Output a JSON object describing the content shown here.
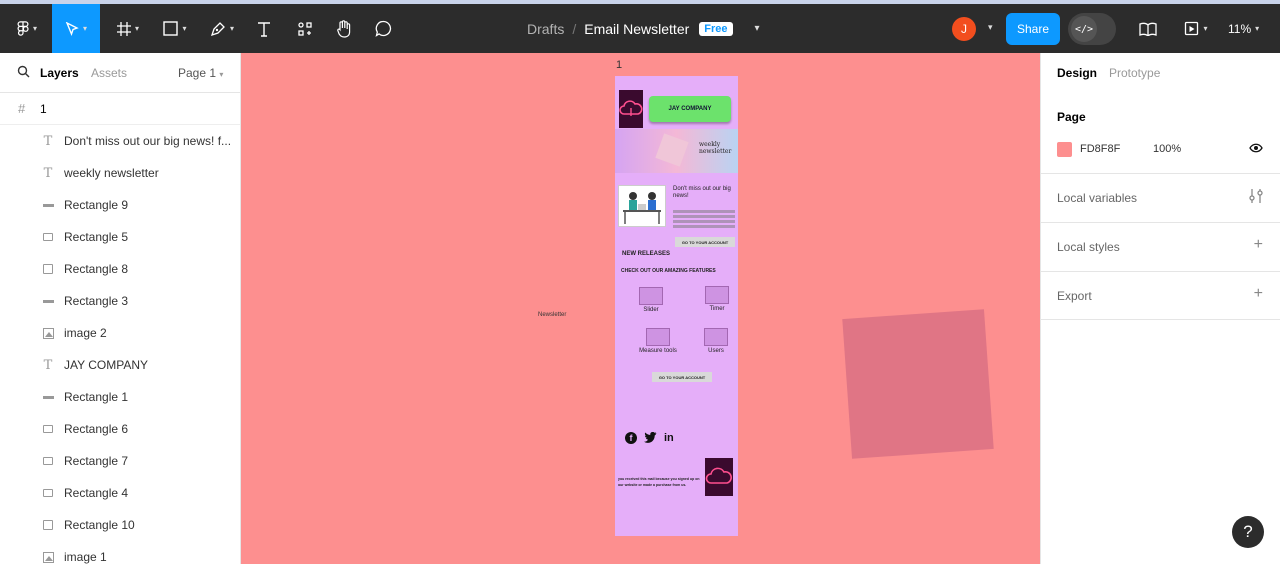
{
  "toolbar": {
    "breadcrumb_drafts": "Drafts",
    "breadcrumb_sep": "/",
    "file_name": "Email Newsletter",
    "plan_badge": "Free",
    "avatar_initial": "J",
    "share_label": "Share",
    "dev_mode_icon": "</>",
    "zoom": "11%",
    "icons": [
      "figma-menu-icon",
      "move-tool-icon",
      "frame-tool-icon",
      "shape-tool-icon",
      "pen-tool-icon",
      "text-tool-icon",
      "resources-icon",
      "hand-tool-icon",
      "comment-icon",
      "library-icon",
      "present-icon"
    ]
  },
  "left_panel": {
    "tab_layers": "Layers",
    "tab_assets": "Assets",
    "page_selector": "Page 1",
    "frame_name": "1",
    "layers": [
      {
        "type": "text",
        "label": "Don't miss out our big news! f..."
      },
      {
        "type": "text",
        "label": "weekly newsletter"
      },
      {
        "type": "line",
        "label": "Rectangle 9"
      },
      {
        "type": "rect",
        "label": "Rectangle 5"
      },
      {
        "type": "square",
        "label": "Rectangle 8"
      },
      {
        "type": "line",
        "label": "Rectangle 3"
      },
      {
        "type": "image",
        "label": "image 2"
      },
      {
        "type": "text",
        "label": "JAY COMPANY"
      },
      {
        "type": "line",
        "label": "Rectangle 1"
      },
      {
        "type": "rect",
        "label": "Rectangle 6"
      },
      {
        "type": "rect",
        "label": "Rectangle 7"
      },
      {
        "type": "rect",
        "label": "Rectangle 4"
      },
      {
        "type": "square",
        "label": "Rectangle 10"
      },
      {
        "type": "image",
        "label": "image 1"
      }
    ]
  },
  "canvas": {
    "background": "#fd8f8f",
    "frame_label": "1",
    "side_label": "Newsletter",
    "email": {
      "company_button": "JAY COMPANY",
      "hero_title_line1": "weekly",
      "hero_title_line2": "newsletter",
      "news_title": "Don't miss out our big news!",
      "cta_1": "GO TO YOUR ACCOUNT",
      "section_new": "NEW RELEASES",
      "features_heading": "CHECK OUT OUR AMAZING FEATURES",
      "features": [
        "Slider",
        "Timer",
        "Measure tools",
        "Users"
      ],
      "cta_2": "GO TO YOUR ACCOUNT",
      "social": [
        "f",
        "twitter",
        "in"
      ],
      "footer": "you received this mail because you signed up on our website or made a purchase from us."
    }
  },
  "right_panel": {
    "tab_design": "Design",
    "tab_prototype": "Prototype",
    "page_heading": "Page",
    "page_color_hex": "FD8F8F",
    "page_color_opacity": "100%",
    "local_variables": "Local variables",
    "local_styles": "Local styles",
    "export": "Export"
  },
  "help_label": "?"
}
